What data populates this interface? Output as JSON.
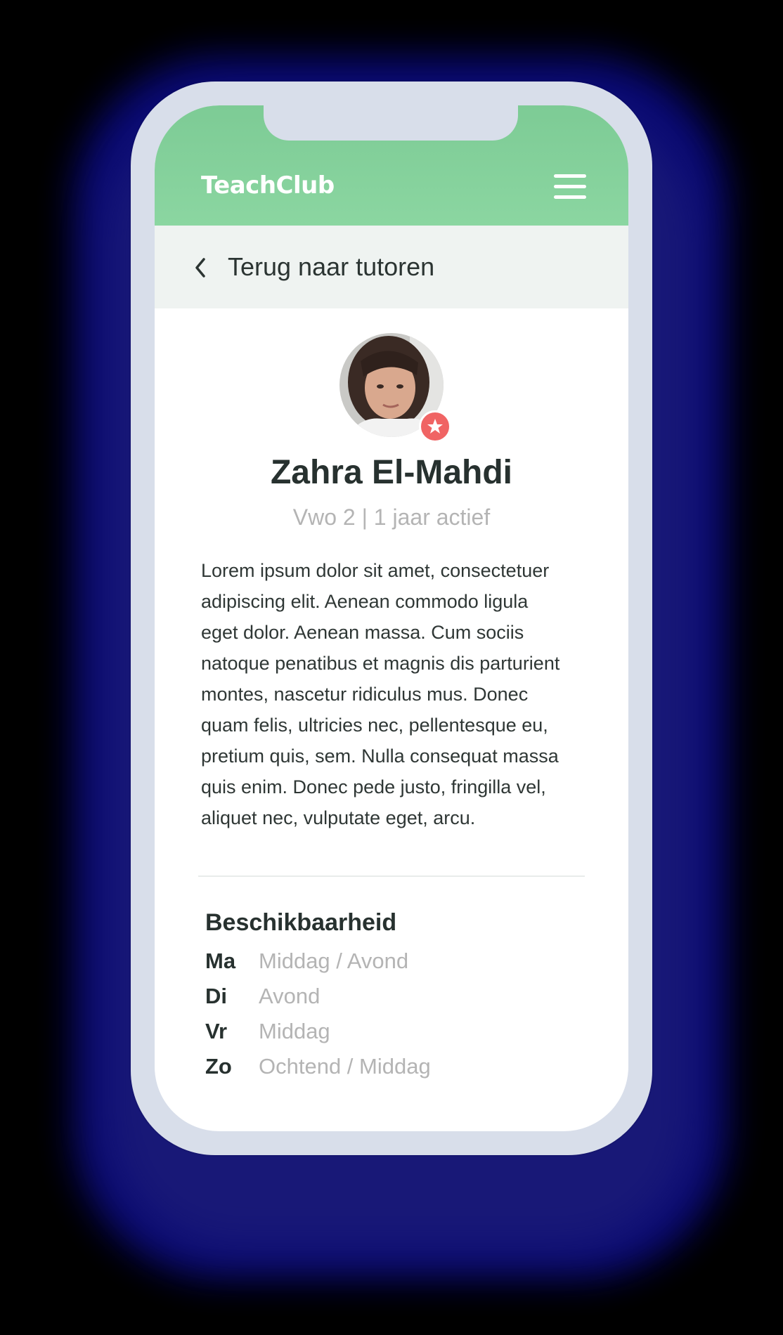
{
  "app": {
    "logo_text": "TeachClub",
    "menu_icon": "hamburger-menu-icon",
    "header_color": "#86d19c"
  },
  "navigation": {
    "back_label": "Terug naar tutoren",
    "back_icon": "chevron-left-icon"
  },
  "profile": {
    "name": "Zahra El-Mahdi",
    "subline": "Vwo 2 | 1 jaar actief",
    "badge_icon": "star-icon",
    "badge_color": "#f06464",
    "bio_lines": [
      "Lorem ipsum dolor sit amet, consectetuer",
      "adipiscing elit. Aenean commodo ligula",
      "eget dolor. Aenean massa. Cum sociis",
      "natoque penatibus et magnis dis parturient",
      "montes, nascetur ridiculus mus. Donec",
      "quam felis, ultricies nec, pellentesque eu,",
      "pretium quis, sem. Nulla consequat massa",
      "quis enim. Donec pede justo, fringilla vel,",
      "aliquet nec, vulputate eget, arcu."
    ]
  },
  "availability": {
    "title": "Beschikbaarheid",
    "rows": [
      {
        "day": "Ma",
        "slot": "Middag / Avond"
      },
      {
        "day": "Di",
        "slot": "Avond"
      },
      {
        "day": "Vr",
        "slot": "Middag"
      },
      {
        "day": "Zo",
        "slot": "Ochtend / Middag"
      }
    ]
  }
}
